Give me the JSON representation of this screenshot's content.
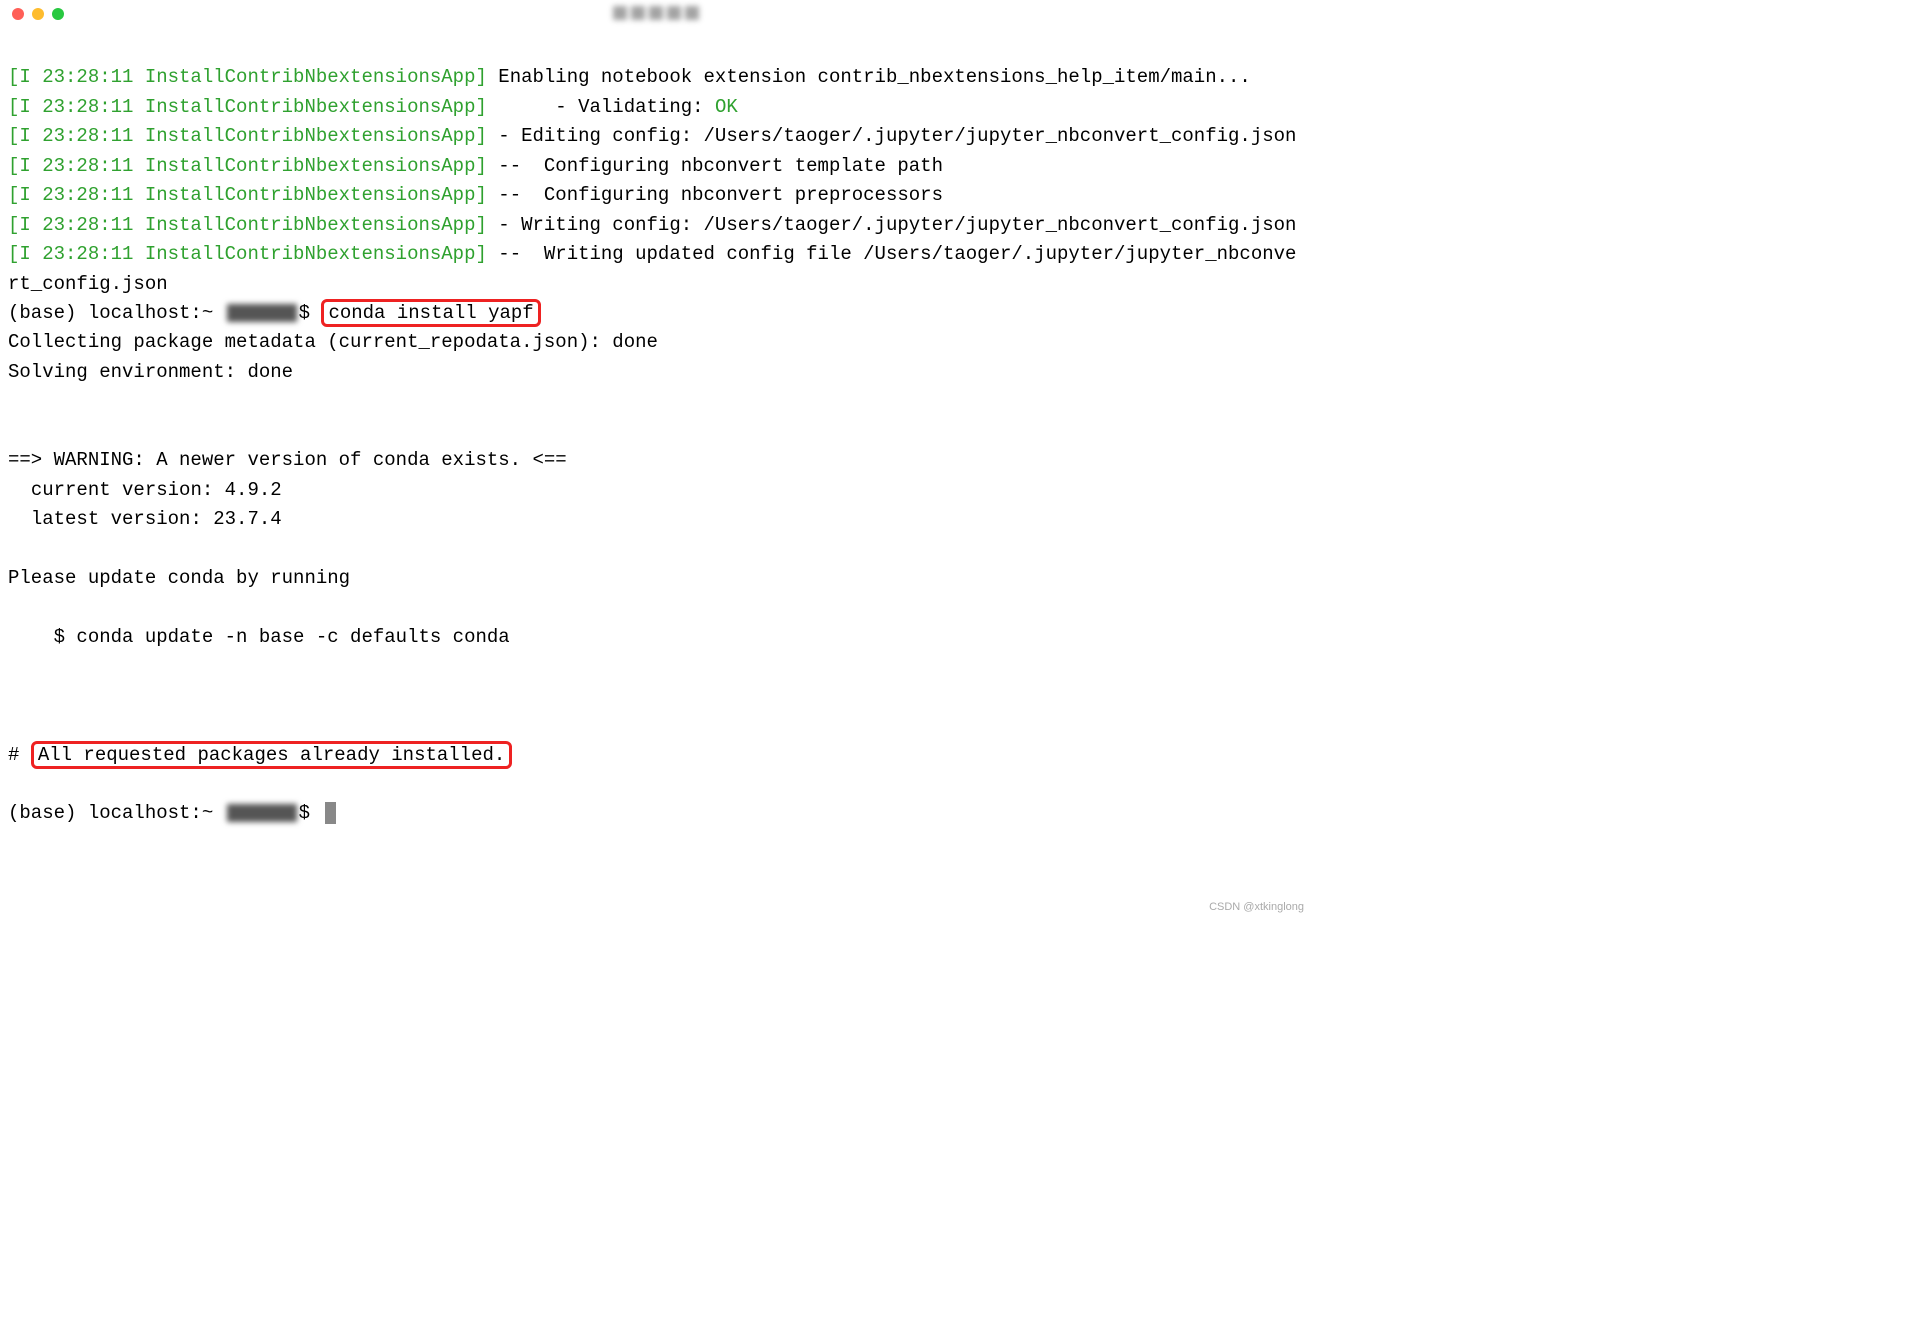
{
  "log_prefix": "[I 23:28:11 InstallContribNbextensionsApp]",
  "lines": {
    "l1_rest": " Enabling notebook extension contrib_nbextensions_help_item/main...",
    "l2_rest": "      - Validating: ",
    "l2_ok": "OK",
    "l3_rest": " - Editing config: /Users/taoger/.jupyter/jupyter_nbconvert_config.json",
    "l4_rest": " --  Configuring nbconvert template path",
    "l5_rest": " --  Configuring nbconvert preprocessors",
    "l6_rest": " - Writing config: /Users/taoger/.jupyter/jupyter_nbconvert_config.json",
    "l7_rest": " --  Writing updated config file /Users/taoger/.jupyter/jupyter_nbconvert_config.json"
  },
  "prompt_prefix": "(base) localhost:~ ",
  "prompt_dollar": "$ ",
  "command": "conda install yapf",
  "collecting": "Collecting package metadata (current_repodata.json): done",
  "solving": "Solving environment: done",
  "warning_header": "==> WARNING: A newer version of conda exists. <==",
  "current_version": "  current version: 4.9.2",
  "latest_version": "  latest version: 23.7.4",
  "please_update": "Please update conda by running",
  "update_cmd": "    $ conda update -n base -c defaults conda",
  "hash": "# ",
  "already_installed": "All requested packages already installed.",
  "watermark": "CSDN @xtkinglong"
}
